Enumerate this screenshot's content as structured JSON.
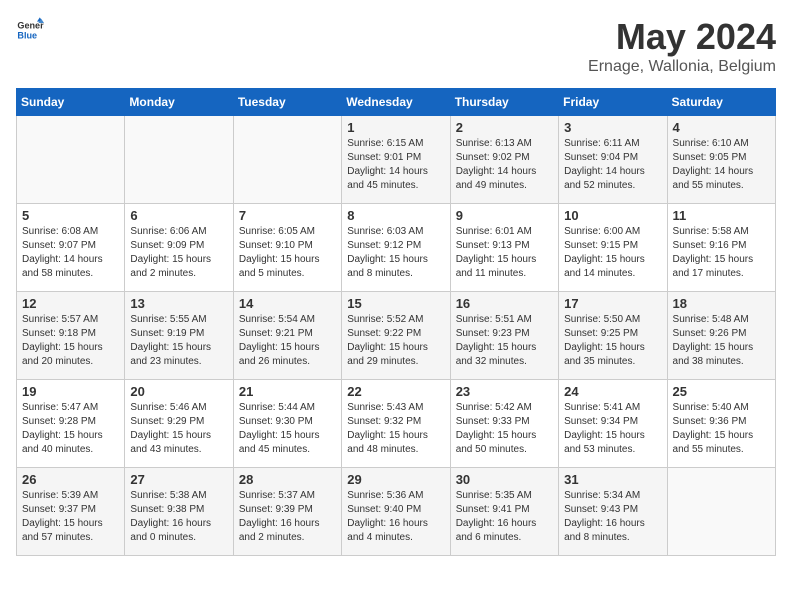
{
  "header": {
    "logo_general": "General",
    "logo_blue": "Blue",
    "month_year": "May 2024",
    "location": "Ernage, Wallonia, Belgium"
  },
  "weekdays": [
    "Sunday",
    "Monday",
    "Tuesday",
    "Wednesday",
    "Thursday",
    "Friday",
    "Saturday"
  ],
  "weeks": [
    {
      "days": [
        {
          "number": "",
          "info": ""
        },
        {
          "number": "",
          "info": ""
        },
        {
          "number": "",
          "info": ""
        },
        {
          "number": "1",
          "info": "Sunrise: 6:15 AM\nSunset: 9:01 PM\nDaylight: 14 hours\nand 45 minutes."
        },
        {
          "number": "2",
          "info": "Sunrise: 6:13 AM\nSunset: 9:02 PM\nDaylight: 14 hours\nand 49 minutes."
        },
        {
          "number": "3",
          "info": "Sunrise: 6:11 AM\nSunset: 9:04 PM\nDaylight: 14 hours\nand 52 minutes."
        },
        {
          "number": "4",
          "info": "Sunrise: 6:10 AM\nSunset: 9:05 PM\nDaylight: 14 hours\nand 55 minutes."
        }
      ]
    },
    {
      "days": [
        {
          "number": "5",
          "info": "Sunrise: 6:08 AM\nSunset: 9:07 PM\nDaylight: 14 hours\nand 58 minutes."
        },
        {
          "number": "6",
          "info": "Sunrise: 6:06 AM\nSunset: 9:09 PM\nDaylight: 15 hours\nand 2 minutes."
        },
        {
          "number": "7",
          "info": "Sunrise: 6:05 AM\nSunset: 9:10 PM\nDaylight: 15 hours\nand 5 minutes."
        },
        {
          "number": "8",
          "info": "Sunrise: 6:03 AM\nSunset: 9:12 PM\nDaylight: 15 hours\nand 8 minutes."
        },
        {
          "number": "9",
          "info": "Sunrise: 6:01 AM\nSunset: 9:13 PM\nDaylight: 15 hours\nand 11 minutes."
        },
        {
          "number": "10",
          "info": "Sunrise: 6:00 AM\nSunset: 9:15 PM\nDaylight: 15 hours\nand 14 minutes."
        },
        {
          "number": "11",
          "info": "Sunrise: 5:58 AM\nSunset: 9:16 PM\nDaylight: 15 hours\nand 17 minutes."
        }
      ]
    },
    {
      "days": [
        {
          "number": "12",
          "info": "Sunrise: 5:57 AM\nSunset: 9:18 PM\nDaylight: 15 hours\nand 20 minutes."
        },
        {
          "number": "13",
          "info": "Sunrise: 5:55 AM\nSunset: 9:19 PM\nDaylight: 15 hours\nand 23 minutes."
        },
        {
          "number": "14",
          "info": "Sunrise: 5:54 AM\nSunset: 9:21 PM\nDaylight: 15 hours\nand 26 minutes."
        },
        {
          "number": "15",
          "info": "Sunrise: 5:52 AM\nSunset: 9:22 PM\nDaylight: 15 hours\nand 29 minutes."
        },
        {
          "number": "16",
          "info": "Sunrise: 5:51 AM\nSunset: 9:23 PM\nDaylight: 15 hours\nand 32 minutes."
        },
        {
          "number": "17",
          "info": "Sunrise: 5:50 AM\nSunset: 9:25 PM\nDaylight: 15 hours\nand 35 minutes."
        },
        {
          "number": "18",
          "info": "Sunrise: 5:48 AM\nSunset: 9:26 PM\nDaylight: 15 hours\nand 38 minutes."
        }
      ]
    },
    {
      "days": [
        {
          "number": "19",
          "info": "Sunrise: 5:47 AM\nSunset: 9:28 PM\nDaylight: 15 hours\nand 40 minutes."
        },
        {
          "number": "20",
          "info": "Sunrise: 5:46 AM\nSunset: 9:29 PM\nDaylight: 15 hours\nand 43 minutes."
        },
        {
          "number": "21",
          "info": "Sunrise: 5:44 AM\nSunset: 9:30 PM\nDaylight: 15 hours\nand 45 minutes."
        },
        {
          "number": "22",
          "info": "Sunrise: 5:43 AM\nSunset: 9:32 PM\nDaylight: 15 hours\nand 48 minutes."
        },
        {
          "number": "23",
          "info": "Sunrise: 5:42 AM\nSunset: 9:33 PM\nDaylight: 15 hours\nand 50 minutes."
        },
        {
          "number": "24",
          "info": "Sunrise: 5:41 AM\nSunset: 9:34 PM\nDaylight: 15 hours\nand 53 minutes."
        },
        {
          "number": "25",
          "info": "Sunrise: 5:40 AM\nSunset: 9:36 PM\nDaylight: 15 hours\nand 55 minutes."
        }
      ]
    },
    {
      "days": [
        {
          "number": "26",
          "info": "Sunrise: 5:39 AM\nSunset: 9:37 PM\nDaylight: 15 hours\nand 57 minutes."
        },
        {
          "number": "27",
          "info": "Sunrise: 5:38 AM\nSunset: 9:38 PM\nDaylight: 16 hours\nand 0 minutes."
        },
        {
          "number": "28",
          "info": "Sunrise: 5:37 AM\nSunset: 9:39 PM\nDaylight: 16 hours\nand 2 minutes."
        },
        {
          "number": "29",
          "info": "Sunrise: 5:36 AM\nSunset: 9:40 PM\nDaylight: 16 hours\nand 4 minutes."
        },
        {
          "number": "30",
          "info": "Sunrise: 5:35 AM\nSunset: 9:41 PM\nDaylight: 16 hours\nand 6 minutes."
        },
        {
          "number": "31",
          "info": "Sunrise: 5:34 AM\nSunset: 9:43 PM\nDaylight: 16 hours\nand 8 minutes."
        },
        {
          "number": "",
          "info": ""
        }
      ]
    }
  ]
}
